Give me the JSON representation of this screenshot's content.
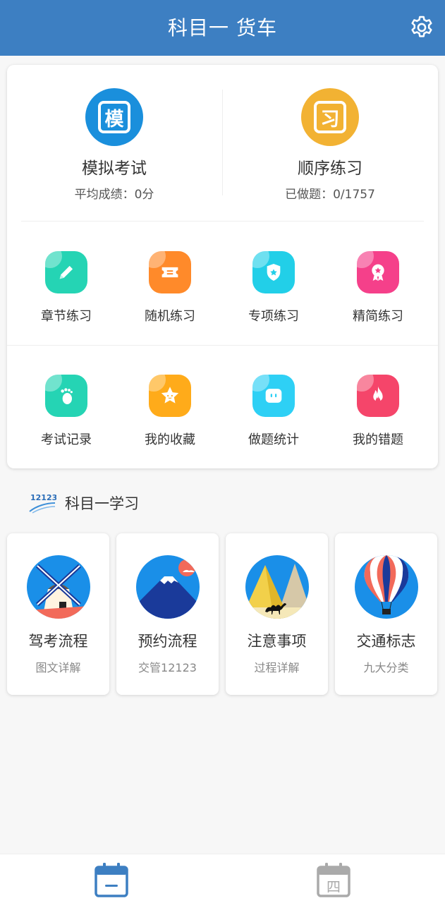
{
  "header": {
    "title": "科目一 货车",
    "settings_icon": "gear-icon"
  },
  "main": {
    "exam": {
      "icon_char": "模",
      "label": "模拟考试",
      "sub": "平均成绩：0分",
      "color": "#1a8fdc"
    },
    "sequence": {
      "icon_char": "习",
      "label": "顺序练习",
      "sub": "已做题：0/1757",
      "color": "#f2b233"
    },
    "grid": [
      {
        "label": "章节练习",
        "icon": "pencil-icon",
        "color": "#25d4b4"
      },
      {
        "label": "随机练习",
        "icon": "ticket-icon",
        "color": "#ff8a2a"
      },
      {
        "label": "专项练习",
        "icon": "shield-star-icon",
        "color": "#22cfe8"
      },
      {
        "label": "精简练习",
        "icon": "award-icon",
        "color": "#f5408a"
      },
      {
        "label": "考试记录",
        "icon": "footprint-icon",
        "color": "#25d4b4"
      },
      {
        "label": "我的收藏",
        "icon": "star-icon",
        "color": "#ffab1a"
      },
      {
        "label": "做题统计",
        "icon": "chat-bubble-icon",
        "color": "#2ed0f5"
      },
      {
        "label": "我的错题",
        "icon": "flame-icon",
        "color": "#f5456a"
      }
    ]
  },
  "study": {
    "logo_text": "12123",
    "title": "科目一学习",
    "cards": [
      {
        "label": "驾考流程",
        "sub": "图文详解",
        "icon": "windmill-icon"
      },
      {
        "label": "预约流程",
        "sub": "交管12123",
        "icon": "mount-fuji-icon"
      },
      {
        "label": "注意事项",
        "sub": "过程详解",
        "icon": "pyramid-camel-icon"
      },
      {
        "label": "交通标志",
        "sub": "九大分类",
        "icon": "hot-air-balloon-icon"
      }
    ]
  },
  "tabbar": {
    "tab1_icon": "calendar-icon",
    "tab2_icon": "calendar-four-icon",
    "tab2_char": "四"
  },
  "colors": {
    "header": "#3d7fc2",
    "accent": "#3d7fc2"
  }
}
